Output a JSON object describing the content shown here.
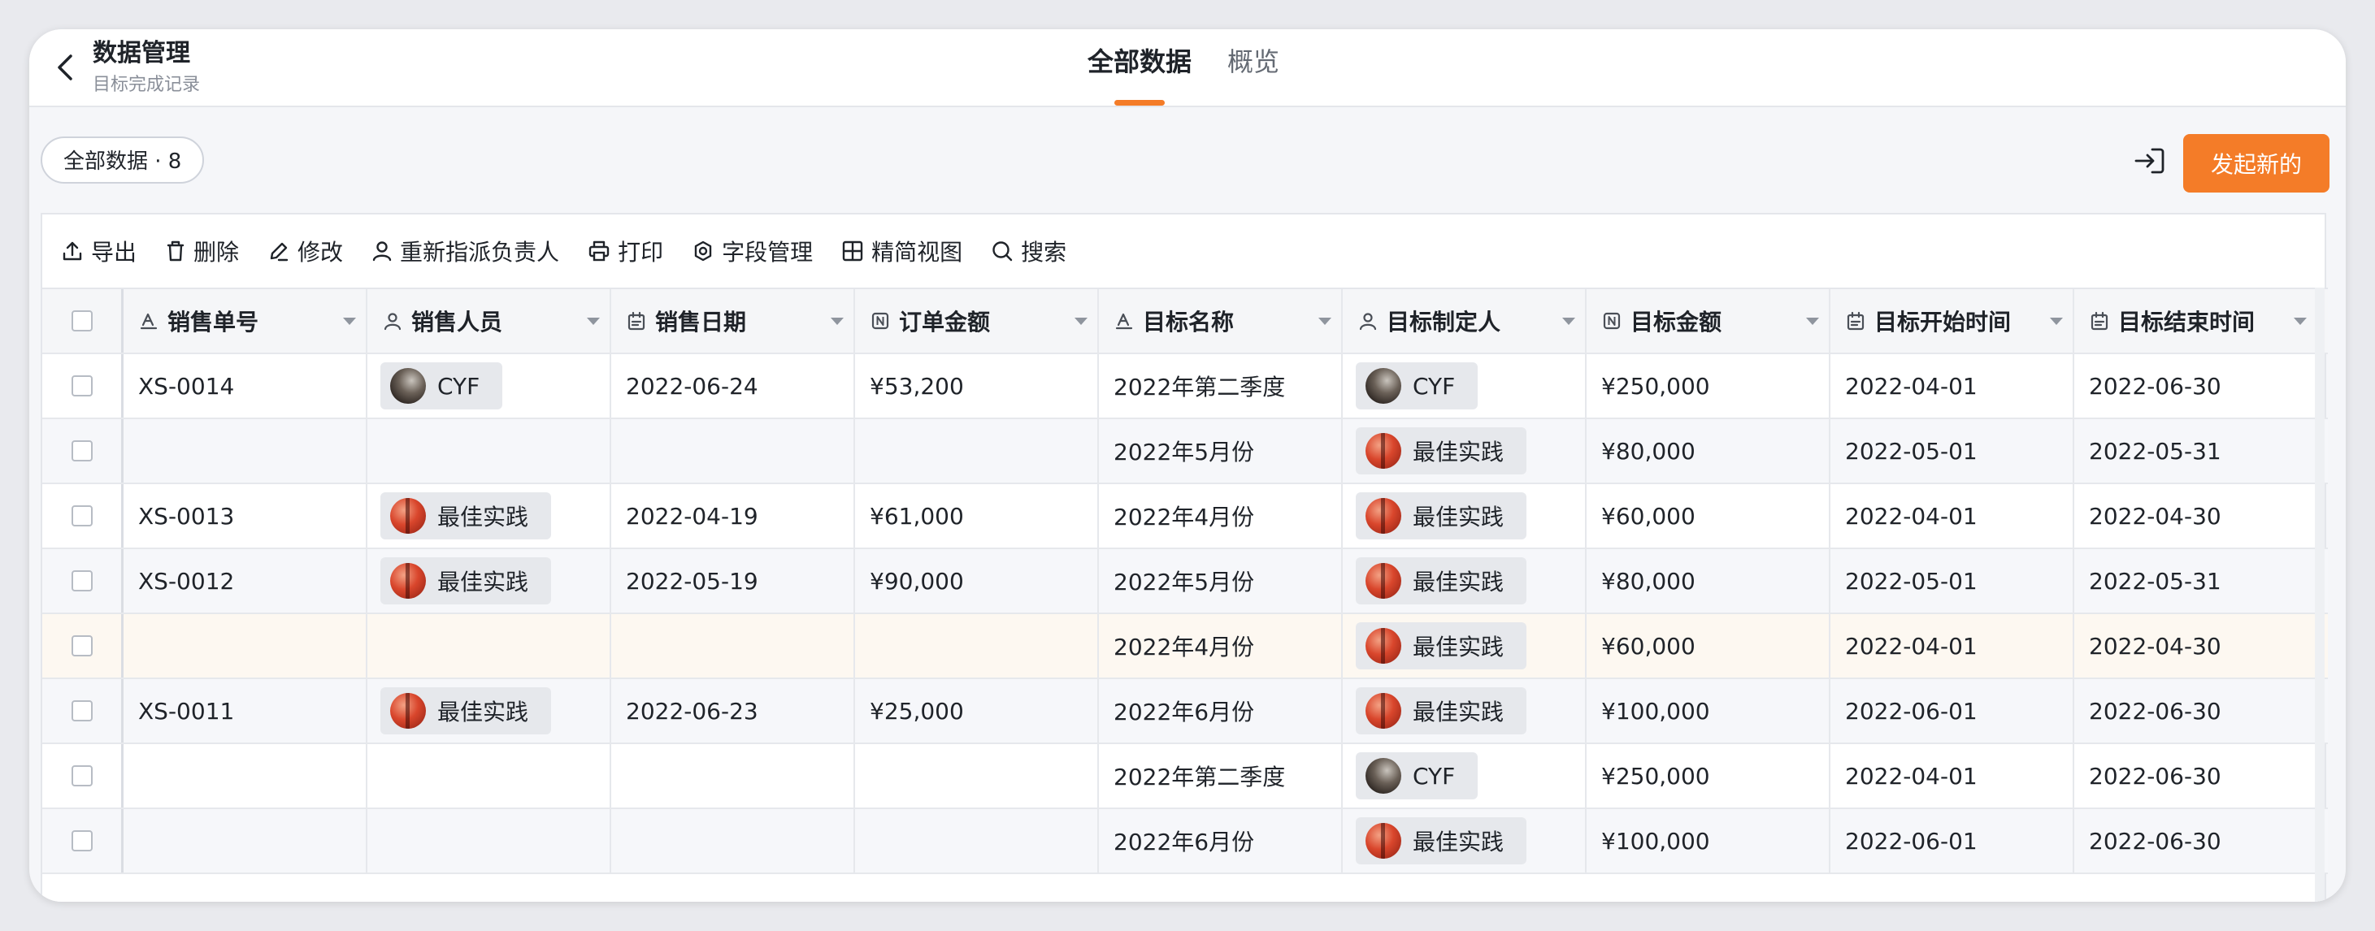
{
  "header": {
    "title": "数据管理",
    "subtitle": "目标完成记录",
    "tabs": [
      {
        "label": "全部数据",
        "active": true
      },
      {
        "label": "概览",
        "active": false
      }
    ]
  },
  "filter_chip": "全部数据 · 8",
  "primary_button": "发起新的",
  "toolbar": {
    "items": [
      {
        "label": "导出",
        "icon": "upload-icon"
      },
      {
        "label": "删除",
        "icon": "trash-icon"
      },
      {
        "label": "修改",
        "icon": "edit-icon"
      },
      {
        "label": "重新指派负责人",
        "icon": "user-icon"
      },
      {
        "label": "打印",
        "icon": "printer-icon"
      },
      {
        "label": "字段管理",
        "icon": "field-settings-icon"
      },
      {
        "label": "精简视图",
        "icon": "grid-icon"
      },
      {
        "label": "搜索",
        "icon": "search-icon"
      }
    ]
  },
  "table": {
    "columns": [
      {
        "label": "销售单号",
        "icon": "text-type-icon"
      },
      {
        "label": "销售人员",
        "icon": "person-type-icon"
      },
      {
        "label": "销售日期",
        "icon": "date-type-icon"
      },
      {
        "label": "订单金额",
        "icon": "number-type-icon"
      },
      {
        "label": "目标名称",
        "icon": "text-type-icon"
      },
      {
        "label": "目标制定人",
        "icon": "person-type-icon"
      },
      {
        "label": "目标金额",
        "icon": "number-type-icon"
      },
      {
        "label": "目标开始时间",
        "icon": "date-type-icon"
      },
      {
        "label": "目标结束时间",
        "icon": "date-type-icon"
      }
    ],
    "rows": [
      {
        "order_no": "XS-0014",
        "sales_person": "CYF",
        "sales_avatar": "photo",
        "sale_date": "2022-06-24",
        "order_amount": "¥53,200",
        "goal_name": "2022年第二季度",
        "goal_owner": "CYF",
        "owner_avatar": "photo",
        "goal_amount": "¥250,000",
        "start": "2022-04-01",
        "end": "2022-06-30",
        "style": "normal"
      },
      {
        "order_no": "",
        "sales_person": "",
        "sales_avatar": "",
        "sale_date": "",
        "order_amount": "",
        "goal_name": "2022年5月份",
        "goal_owner": "最佳实践",
        "owner_avatar": "ball",
        "goal_amount": "¥80,000",
        "start": "2022-05-01",
        "end": "2022-05-31",
        "style": "alt"
      },
      {
        "order_no": "XS-0013",
        "sales_person": "最佳实践",
        "sales_avatar": "ball",
        "sale_date": "2022-04-19",
        "order_amount": "¥61,000",
        "goal_name": "2022年4月份",
        "goal_owner": "最佳实践",
        "owner_avatar": "ball",
        "goal_amount": "¥60,000",
        "start": "2022-04-01",
        "end": "2022-04-30",
        "style": "normal"
      },
      {
        "order_no": "XS-0012",
        "sales_person": "最佳实践",
        "sales_avatar": "ball",
        "sale_date": "2022-05-19",
        "order_amount": "¥90,000",
        "goal_name": "2022年5月份",
        "goal_owner": "最佳实践",
        "owner_avatar": "ball",
        "goal_amount": "¥80,000",
        "start": "2022-05-01",
        "end": "2022-05-31",
        "style": "alt"
      },
      {
        "order_no": "",
        "sales_person": "",
        "sales_avatar": "",
        "sale_date": "",
        "order_amount": "",
        "goal_name": "2022年4月份",
        "goal_owner": "最佳实践",
        "owner_avatar": "ball",
        "goal_amount": "¥60,000",
        "start": "2022-04-01",
        "end": "2022-04-30",
        "style": "hl"
      },
      {
        "order_no": "XS-0011",
        "sales_person": "最佳实践",
        "sales_avatar": "ball",
        "sale_date": "2022-06-23",
        "order_amount": "¥25,000",
        "goal_name": "2022年6月份",
        "goal_owner": "最佳实践",
        "owner_avatar": "ball",
        "goal_amount": "¥100,000",
        "start": "2022-06-01",
        "end": "2022-06-30",
        "style": "alt"
      },
      {
        "order_no": "",
        "sales_person": "",
        "sales_avatar": "",
        "sale_date": "",
        "order_amount": "",
        "goal_name": "2022年第二季度",
        "goal_owner": "CYF",
        "owner_avatar": "photo",
        "goal_amount": "¥250,000",
        "start": "2022-04-01",
        "end": "2022-06-30",
        "style": "normal"
      },
      {
        "order_no": "",
        "sales_person": "",
        "sales_avatar": "",
        "sale_date": "",
        "order_amount": "",
        "goal_name": "2022年6月份",
        "goal_owner": "最佳实践",
        "owner_avatar": "ball",
        "goal_amount": "¥100,000",
        "start": "2022-06-01",
        "end": "2022-06-30",
        "style": "alt"
      }
    ]
  },
  "colors": {
    "accent": "#f47c28",
    "highlight_row": "#fdf8f1"
  }
}
